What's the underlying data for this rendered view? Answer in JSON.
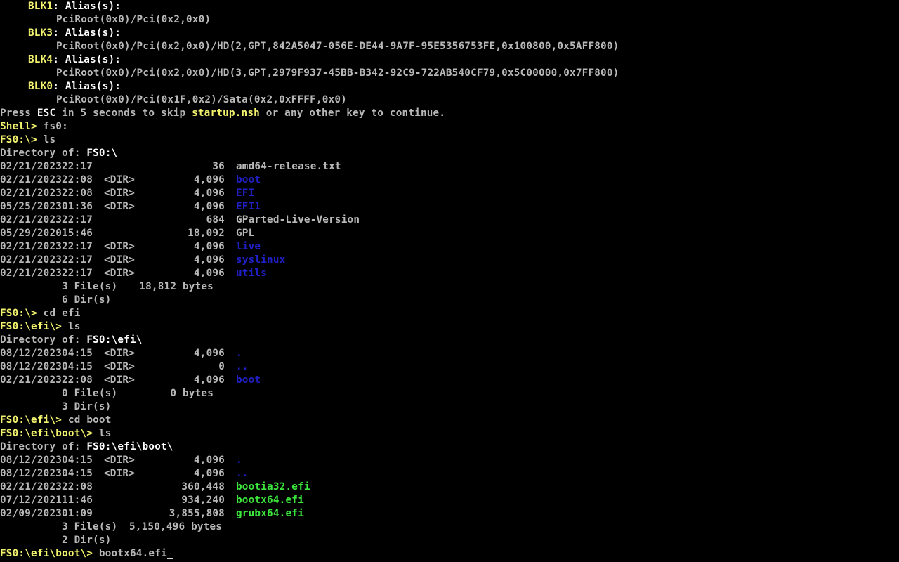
{
  "devices": [
    {
      "name": "BLK1",
      "alias_label": ": Alias(s):",
      "path": "PciRoot(0x0)/Pci(0x2,0x0)"
    },
    {
      "name": "BLK3",
      "alias_label": ": Alias(s):",
      "path": "PciRoot(0x0)/Pci(0x2,0x0)/HD(2,GPT,842A5047-056E-DE44-9A7F-95E5356753FE,0x100800,0x5AFF800)"
    },
    {
      "name": "BLK4",
      "alias_label": ": Alias(s):",
      "path": "PciRoot(0x0)/Pci(0x2,0x0)/HD(3,GPT,2979F937-45BB-B342-92C9-722AB540CF79,0x5C00000,0x7FF800)"
    },
    {
      "name": "BLK0",
      "alias_label": ": Alias(s):",
      "path": "PciRoot(0x0)/Pci(0x1F,0x2)/Sata(0x2,0xFFFF,0x0)"
    }
  ],
  "startup": {
    "pre": "Press ",
    "esc": "ESC",
    "mid": " in 5 seconds to skip ",
    "script": "startup.nsh",
    "post": " or any other key to continue."
  },
  "cmd1": {
    "prompt": "Shell> ",
    "command": "fs0:"
  },
  "cmd2": {
    "prompt": "FS0:\\> ",
    "command": "ls"
  },
  "dir1": {
    "header_label": "Directory of: ",
    "path": "FS0:\\",
    "entries": [
      {
        "date": "02/21/2023",
        "time": "22:17",
        "dir": "",
        "size": "36",
        "name": "amd64-release.txt"
      },
      {
        "date": "02/21/2023",
        "time": "22:08",
        "dir": "<DIR>",
        "size": "4,096",
        "name": "boot"
      },
      {
        "date": "02/21/2023",
        "time": "22:08",
        "dir": "<DIR>",
        "size": "4,096",
        "name": "EFI"
      },
      {
        "date": "05/25/2023",
        "time": "01:36",
        "dir": "<DIR>",
        "size": "4,096",
        "name": "EFI1"
      },
      {
        "date": "02/21/2023",
        "time": "22:17",
        "dir": "",
        "size": "684",
        "name": "GParted-Live-Version"
      },
      {
        "date": "05/29/2020",
        "time": "15:46",
        "dir": "",
        "size": "18,092",
        "name": "GPL"
      },
      {
        "date": "02/21/2023",
        "time": "22:17",
        "dir": "<DIR>",
        "size": "4,096",
        "name": "live"
      },
      {
        "date": "02/21/2023",
        "time": "22:17",
        "dir": "<DIR>",
        "size": "4,096",
        "name": "syslinux"
      },
      {
        "date": "02/21/2023",
        "time": "22:17",
        "dir": "<DIR>",
        "size": "4,096",
        "name": "utils"
      }
    ],
    "files_count": "3 File(s)",
    "files_bytes": "18,812 bytes",
    "dirs_count": "6 Dir(s)"
  },
  "cmd3": {
    "prompt": "FS0:\\> ",
    "command": "cd efi"
  },
  "cmd4": {
    "prompt": "FS0:\\efi\\> ",
    "command": "ls"
  },
  "dir2": {
    "header_label": "Directory of: ",
    "path": "FS0:\\efi\\",
    "entries": [
      {
        "date": "08/12/2023",
        "time": "04:15",
        "dir": "<DIR>",
        "size": "4,096",
        "name": "."
      },
      {
        "date": "08/12/2023",
        "time": "04:15",
        "dir": "<DIR>",
        "size": "0",
        "name": ".."
      },
      {
        "date": "02/21/2023",
        "time": "22:08",
        "dir": "<DIR>",
        "size": "4,096",
        "name": "boot"
      }
    ],
    "files_count": "0 File(s)",
    "files_bytes": "0 bytes",
    "dirs_count": "3 Dir(s)"
  },
  "cmd5": {
    "prompt": "FS0:\\efi\\> ",
    "command": "cd boot"
  },
  "cmd6": {
    "prompt": "FS0:\\efi\\boot\\> ",
    "command": "ls"
  },
  "dir3": {
    "header_label": "Directory of: ",
    "path": "FS0:\\efi\\boot\\",
    "entries": [
      {
        "date": "08/12/2023",
        "time": "04:15",
        "dir": "<DIR>",
        "size": "4,096",
        "name": "."
      },
      {
        "date": "08/12/2023",
        "time": "04:15",
        "dir": "<DIR>",
        "size": "4,096",
        "name": ".."
      },
      {
        "date": "02/21/2023",
        "time": "22:08",
        "dir": "",
        "size": "360,448",
        "name": "bootia32.efi"
      },
      {
        "date": "07/12/2021",
        "time": "11:46",
        "dir": "",
        "size": "934,240",
        "name": "bootx64.efi"
      },
      {
        "date": "02/09/2023",
        "time": "01:09",
        "dir": "",
        "size": "3,855,808",
        "name": "grubx64.efi"
      }
    ],
    "files_count": "3 File(s)",
    "files_bytes": "5,150,496 bytes",
    "dirs_count": "2 Dir(s)"
  },
  "cmd7": {
    "prompt": "FS0:\\efi\\boot\\> ",
    "command": "bootx64.efi"
  },
  "colors": {
    "background": "#000000",
    "prompt": "#f2f26e",
    "text": "#b8b8b8",
    "highlight": "#ffffff",
    "directory": "#2020c8",
    "executable": "#3ce63c"
  }
}
